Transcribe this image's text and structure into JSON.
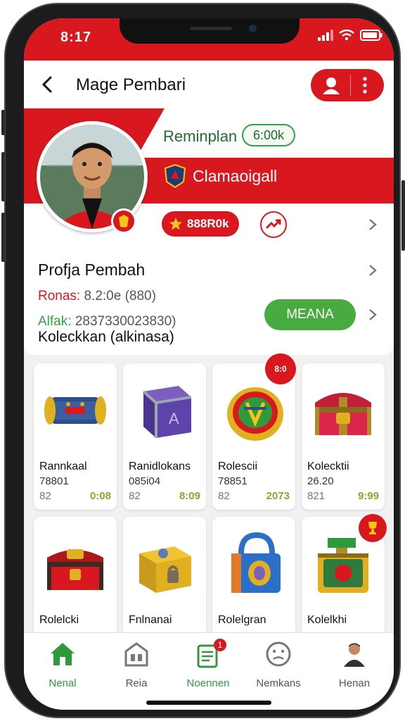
{
  "status": {
    "time": "8:17"
  },
  "header": {
    "title": "Mage Pembari"
  },
  "profile": {
    "name": "Reminplan",
    "coins": "6:00k",
    "club": "Clamaoigall",
    "rating": "888R0k",
    "section_title": "Profja Pembah",
    "bonus_label": "Ronas:",
    "bonus_value": "8.2:0e (880)",
    "id_label": "Alfak:",
    "id_value": "2837330023830)",
    "action_button": "MEANA",
    "collection_title": "Koleckkan (alkinasa)"
  },
  "items": [
    {
      "name": "Rannkaal",
      "code": "78801",
      "qty": "82",
      "price": "0:08",
      "icon": "treasure-scroll-icon"
    },
    {
      "name": "Ranidlokans",
      "code": "085i04",
      "qty": "82",
      "price": "8:09",
      "icon": "rune-box-icon"
    },
    {
      "name": "Rolescii",
      "code": "78851",
      "qty": "82",
      "price": "2073",
      "icon": "golden-shield-icon",
      "tag": "8:0"
    },
    {
      "name": "Kolecktii",
      "code": "26.20",
      "qty": "821",
      "price": "9:99",
      "icon": "red-chest-icon"
    },
    {
      "name": "Rolelcki",
      "code": "",
      "qty": "",
      "price": "",
      "icon": "red-trunk-icon"
    },
    {
      "name": "Fnlnanai",
      "code": "",
      "qty": "",
      "price": "",
      "icon": "locked-chest-icon"
    },
    {
      "name": "Rolelgran",
      "code": "",
      "qty": "",
      "price": "",
      "icon": "blue-padlock-icon"
    },
    {
      "name": "Kolelkhi",
      "code": "",
      "qty": "",
      "price": "",
      "icon": "gift-chest-icon"
    }
  ],
  "nav": [
    {
      "label": "Nenal",
      "icon": "home-icon",
      "active": true
    },
    {
      "label": "Reia",
      "icon": "store-icon",
      "active": false
    },
    {
      "label": "Noennen",
      "icon": "notes-icon",
      "active": true,
      "badge": "1"
    },
    {
      "label": "Nemkans",
      "icon": "face-icon",
      "active": false
    },
    {
      "label": "Henan",
      "icon": "profile-icon",
      "active": false
    }
  ],
  "colors": {
    "brand_red": "#d9171f",
    "accent_green": "#47ab3f",
    "price_green": "#8aa72a"
  }
}
